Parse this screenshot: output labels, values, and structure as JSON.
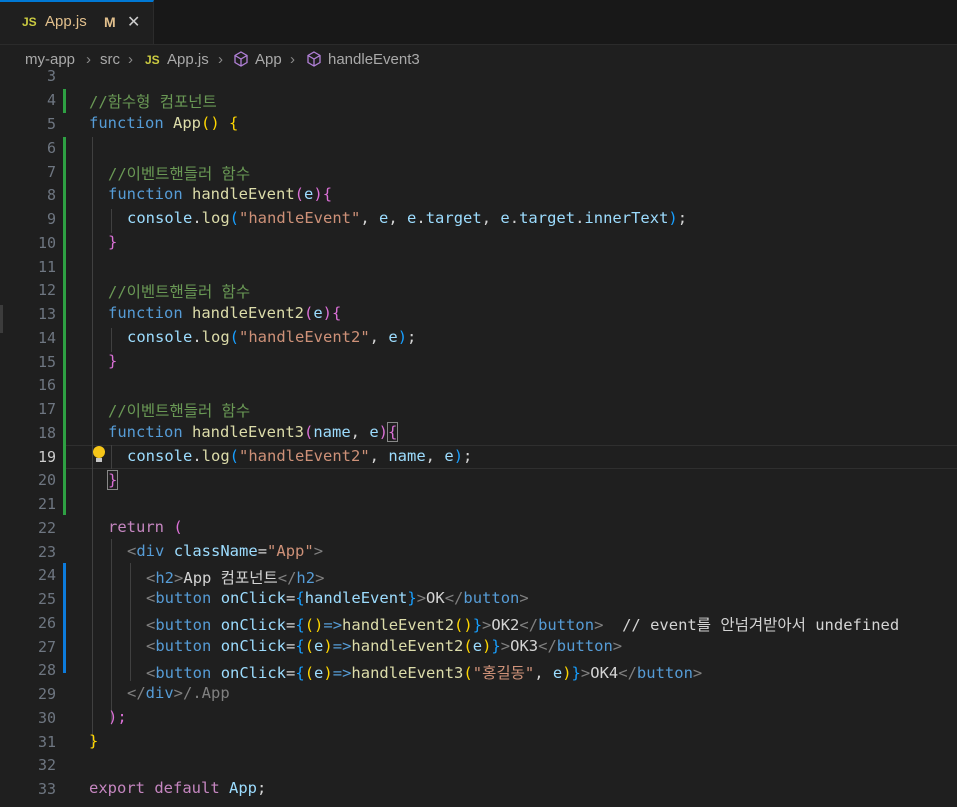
{
  "tab": {
    "lang_badge": "JS",
    "file_name": "App.js",
    "modified_marker": "M",
    "close_glyph": "✕"
  },
  "breadcrumb": {
    "folder1": "my-app",
    "folder2": "src",
    "lang_badge": "JS",
    "file": "App.js",
    "symbol1": "App",
    "symbol2": "handleEvent3",
    "sep": "›"
  },
  "line_numbers": [
    "3",
    "4",
    "5",
    "6",
    "7",
    "8",
    "9",
    "10",
    "11",
    "12",
    "13",
    "14",
    "15",
    "16",
    "17",
    "18",
    "19",
    "20",
    "21",
    "22",
    "23",
    "24",
    "25",
    "26",
    "27",
    "28",
    "29",
    "30",
    "31",
    "32",
    "33"
  ],
  "active_line": "19",
  "code": {
    "l4": "//함수형 컴포넌트",
    "l5_kw": "function",
    "l5_fn": "App",
    "l5_open": "()",
    "l5_brace": "{",
    "l7": "//이벤트핸들러 함수",
    "l8_kw": "function",
    "l8_fn": "handleEvent",
    "l8_p1": "(",
    "l8_arg": "e",
    "l8_p2": ")",
    "l8_brace": "{",
    "l9_obj": "console",
    "l9_dot": ".",
    "l9_fn": "log",
    "l9_p1": "(",
    "l9_str": "\"handleEvent\"",
    "l9_rest1": ", ",
    "l9_e": "e",
    "l9_rest2": ", ",
    "l9_e2": "e",
    "l9_dot2": ".",
    "l9_target": "target",
    "l9_rest3": ", ",
    "l9_e3": "e",
    "l9_dot3": ".",
    "l9_target2": "target",
    "l9_dot4": ".",
    "l9_inner": "innerText",
    "l9_p2": ")",
    "l9_semi": ";",
    "l10": "}",
    "l12": "//이벤트핸들러 함수",
    "l13_kw": "function",
    "l13_fn": "handleEvent2",
    "l13_p1": "(",
    "l13_arg": "e",
    "l13_p2": ")",
    "l13_brace": "{",
    "l14_obj": "console",
    "l14_dot": ".",
    "l14_fn": "log",
    "l14_p1": "(",
    "l14_str": "\"handleEvent2\"",
    "l14_sep": ", ",
    "l14_e": "e",
    "l14_p2": ")",
    "l14_semi": ";",
    "l15": "}",
    "l17": "//이벤트핸들러 함수",
    "l18_kw": "function",
    "l18_fn": "handleEvent3",
    "l18_p1": "(",
    "l18_arg1": "name",
    "l18_sep": ", ",
    "l18_arg2": "e",
    "l18_p2": ")",
    "l18_brace": "{",
    "l19_obj": "console",
    "l19_dot": ".",
    "l19_fn": "log",
    "l19_p1": "(",
    "l19_str": "\"handleEvent2\"",
    "l19_sep1": ", ",
    "l19_name": "name",
    "l19_sep2": ", ",
    "l19_e": "e",
    "l19_p2": ")",
    "l19_semi": ";",
    "l20": "}",
    "l22_kw": "return",
    "l22_p": "(",
    "l23_lt": "<",
    "l23_tag": "div",
    "l23_attr": "className",
    "l23_eq": "=",
    "l23_val": "\"App\"",
    "l23_gt": ">",
    "l24_lt": "<",
    "l24_tag": "h2",
    "l24_gt": ">",
    "l24_text": "App 컴포넌트",
    "l24_close_lt": "</",
    "l24_close_tag": "h2",
    "l24_close_gt": ">",
    "l25_lt": "<",
    "l25_tag": "button",
    "l25_attr": "onClick",
    "l25_eq": "=",
    "l25_b1": "{",
    "l25_fn": "handleEvent",
    "l25_b2": "}",
    "l25_gt": ">",
    "l25_text": "OK",
    "l25_close_lt": "</",
    "l25_close_tag": "button",
    "l25_close_gt": ">",
    "l26_lt": "<",
    "l26_tag": "button",
    "l26_attr": "onClick",
    "l26_eq": "=",
    "l26_b1": "{",
    "l26_par": "()",
    "l26_arrow": "=>",
    "l26_fn": "handleEvent2",
    "l26_call": "()",
    "l26_b2": "}",
    "l26_gt": ">",
    "l26_text": "OK2",
    "l26_close_lt": "</",
    "l26_close_tag": "button",
    "l26_close_gt": ">",
    "l26_comment": "// event를 안넘겨받아서 undefined",
    "l27_lt": "<",
    "l27_tag": "button",
    "l27_attr": "onClick",
    "l27_eq": "=",
    "l27_b1": "{",
    "l27_p1": "(",
    "l27_e": "e",
    "l27_p2": ")",
    "l27_arrow": "=>",
    "l27_fn": "handleEvent2",
    "l27_c1": "(",
    "l27_e2": "e",
    "l27_c2": ")",
    "l27_b2": "}",
    "l27_gt": ">",
    "l27_text": "OK3",
    "l27_close_lt": "</",
    "l27_close_tag": "button",
    "l27_close_gt": ">",
    "l28_lt": "<",
    "l28_tag": "button",
    "l28_attr": "onClick",
    "l28_eq": "=",
    "l28_b1": "{",
    "l28_p1": "(",
    "l28_e": "e",
    "l28_p2": ")",
    "l28_arrow": "=>",
    "l28_fn": "handleEvent3",
    "l28_c1": "(",
    "l28_str": "\"홍길동\"",
    "l28_sep": ", ",
    "l28_e2": "e",
    "l28_c2": ")",
    "l28_b2": "}",
    "l28_gt": ">",
    "l28_text": "OK4",
    "l28_close_lt": "</",
    "l28_close_tag": "button",
    "l28_close_gt": ">",
    "l29_lt": "</",
    "l29_tag": "div",
    "l29_gt": ">",
    "l29_hint": "/.App",
    "l30": ");",
    "l31": "}",
    "l33_kw1": "export",
    "l33_kw2": "default",
    "l33_name": "App",
    "l33_semi": ";"
  }
}
